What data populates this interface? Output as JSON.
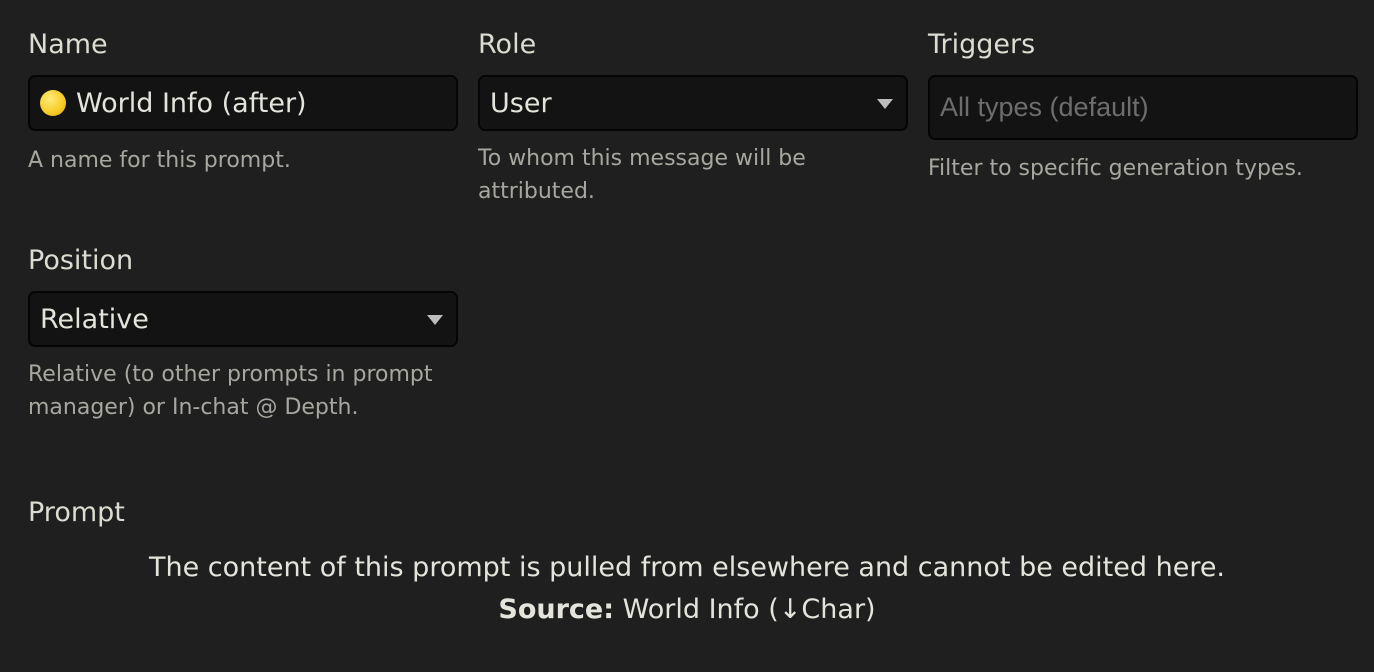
{
  "name": {
    "label": "Name",
    "value": "World Info (after)",
    "icon": "yellow-circle-emoji",
    "hint": "A name for this prompt."
  },
  "role": {
    "label": "Role",
    "selected": "User",
    "hint": "To whom this message will be attributed."
  },
  "triggers": {
    "label": "Triggers",
    "placeholder": "All types (default)",
    "hint": "Filter to specific generation types."
  },
  "position": {
    "label": "Position",
    "selected": "Relative",
    "hint": "Relative (to other prompts in prompt manager) or In-chat @ Depth."
  },
  "prompt": {
    "label": "Prompt",
    "notice": "The content of this prompt is pulled from elsewhere and cannot be edited here.",
    "source_label": "Source:",
    "source_value": "World Info (↓Char)"
  },
  "colors": {
    "background": "#1f1f1f",
    "field_background": "#131313",
    "text": "#dcdcd2",
    "hint_text": "#a7a7a0",
    "placeholder_text": "#6d6d6d"
  }
}
